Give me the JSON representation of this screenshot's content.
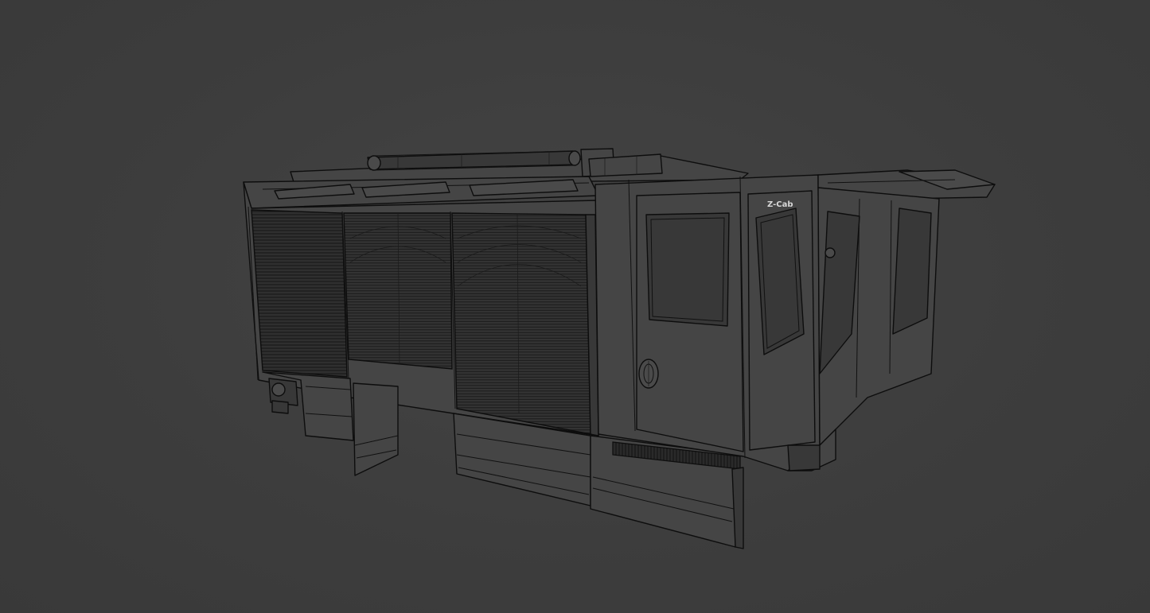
{
  "viewport": {
    "background_color": "#3c3c3c",
    "wire_color": "#0d0d0d",
    "surface_color": "#454545"
  },
  "model": {
    "logo_text": "Z-Cab"
  }
}
